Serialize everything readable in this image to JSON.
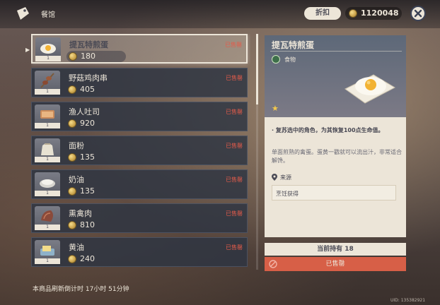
{
  "header": {
    "shop_title": "餐馆",
    "discount_label": "折扣",
    "currency_amount": "1120048"
  },
  "items": [
    {
      "name": "提瓦特煎蛋",
      "price": "180",
      "qty": "1",
      "status": "已售罄",
      "icon": "fried-egg-icon",
      "selected": true
    },
    {
      "name": "野菇鸡肉串",
      "price": "405",
      "qty": "1",
      "status": "已售罄",
      "icon": "skewer-icon"
    },
    {
      "name": "渔人吐司",
      "price": "920",
      "qty": "1",
      "status": "已售罄",
      "icon": "toast-icon"
    },
    {
      "name": "面粉",
      "price": "135",
      "qty": "1",
      "status": "已售罄",
      "icon": "flour-sack-icon"
    },
    {
      "name": "奶油",
      "price": "135",
      "qty": "1",
      "status": "已售罄",
      "icon": "cream-icon"
    },
    {
      "name": "熏禽肉",
      "price": "810",
      "qty": "1",
      "status": "已售罄",
      "icon": "smoked-meat-icon"
    },
    {
      "name": "黄油",
      "price": "240",
      "qty": "1",
      "status": "已售罄",
      "icon": "butter-icon"
    }
  ],
  "detail": {
    "name": "提瓦特煎蛋",
    "category": "食物",
    "stars": "★",
    "effect": "· 复苏选中的角色，为其恢复100点生命值。",
    "description": "单面煎熟的禽蛋。蛋黄一戳就可以流出汁，非常适合解馋。",
    "source_label": "来源",
    "source_value": "烹饪获得",
    "owned": "当前持有 18",
    "action_label": "已售罄"
  },
  "footer": {
    "refresh_text": "本商品刷新倒计时 17小时 51分钟",
    "uid": "UID: 135382921"
  },
  "colors": {
    "cream": "#ece5d8",
    "sold_red": "#e35b4a",
    "button_red": "#d75f47",
    "star_gold": "#f4c94b"
  }
}
